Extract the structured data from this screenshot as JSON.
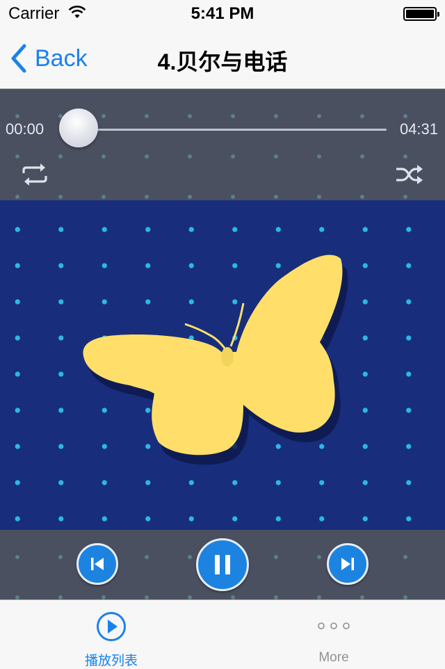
{
  "status_bar": {
    "carrier": "Carrier",
    "time": "5:41 PM"
  },
  "nav": {
    "back_label": "Back",
    "title": "4.贝尔与电话"
  },
  "player": {
    "elapsed": "00:00",
    "duration": "04:31",
    "progress": 0.0,
    "is_playing": true
  },
  "icons": {
    "repeat": "repeat-icon",
    "shuffle": "shuffle-icon",
    "previous": "skip-previous-icon",
    "pause": "pause-icon",
    "next": "skip-next-icon",
    "playlist": "play-circle-icon",
    "more": "more-dots-icon",
    "artwork": "butterfly"
  },
  "tabs": [
    {
      "label": "播放列表",
      "selected": true
    },
    {
      "label": "More",
      "selected": false
    }
  ],
  "colors": {
    "accent": "#1a82ec",
    "panel": "#4b5061",
    "artwork_bg": "#182d7c",
    "artwork_dot": "#2bb8e8",
    "butterfly": "#ffdf6a",
    "control": "#1d83e1"
  }
}
